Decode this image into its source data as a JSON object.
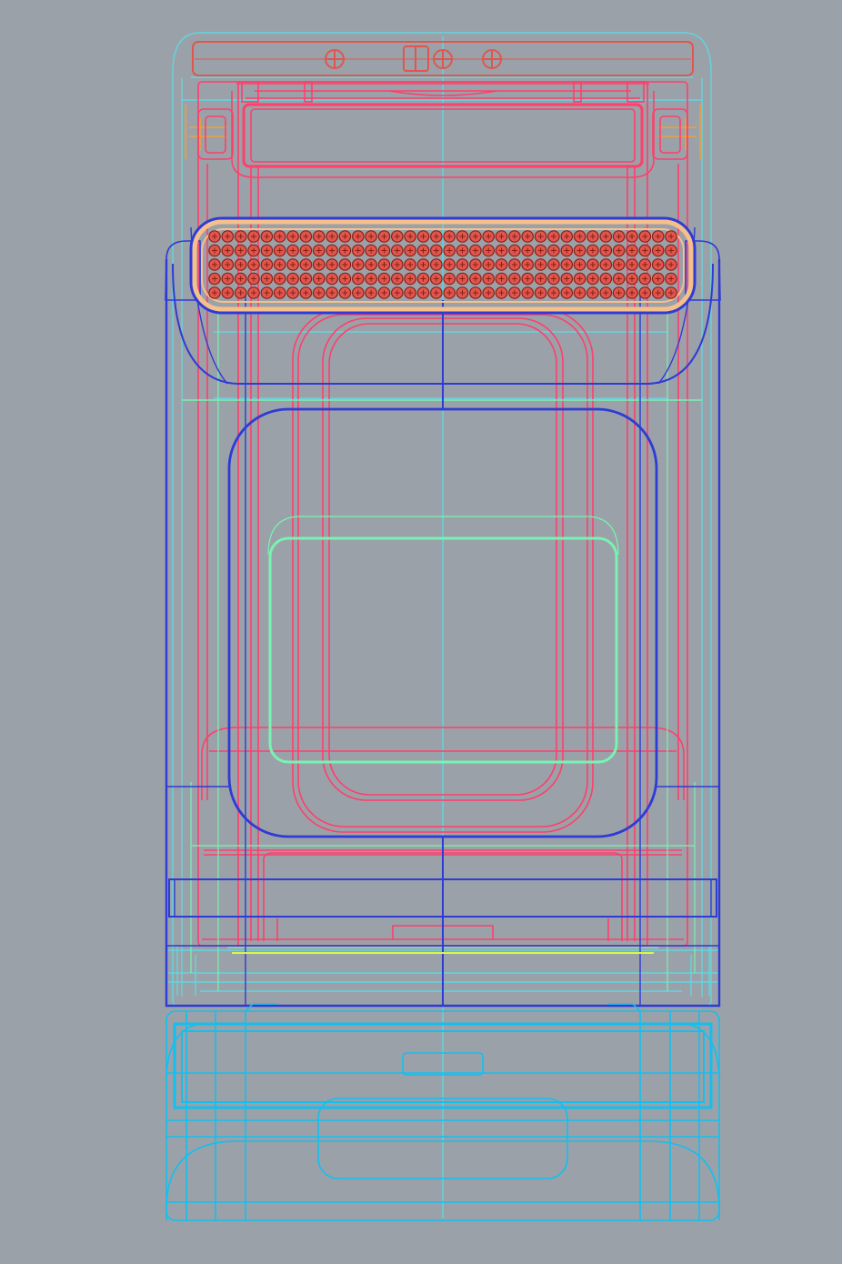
{
  "viewport": {
    "background": "#9ba1a8"
  },
  "layers": {
    "appliance_top": {
      "color": "#e0564f"
    },
    "frame_pink": {
      "color": "#ff3f6c"
    },
    "body_blue": {
      "color": "#2e3bd6"
    },
    "vent_orange": {
      "color": "#f5c08a"
    },
    "vent_holes": {
      "color": "#8a1e10",
      "fill": "#e0564f"
    },
    "guides_cyan": {
      "color": "#62d6df"
    },
    "inner_green": {
      "color": "#79f2b3"
    },
    "drawer_cyan": {
      "color": "#12c0f0"
    },
    "hinge_amber": {
      "color": "#ffa020"
    },
    "rail_yellow": {
      "color": "#e3f540"
    }
  },
  "vent_grid": {
    "rows": 5,
    "cols": 36
  }
}
